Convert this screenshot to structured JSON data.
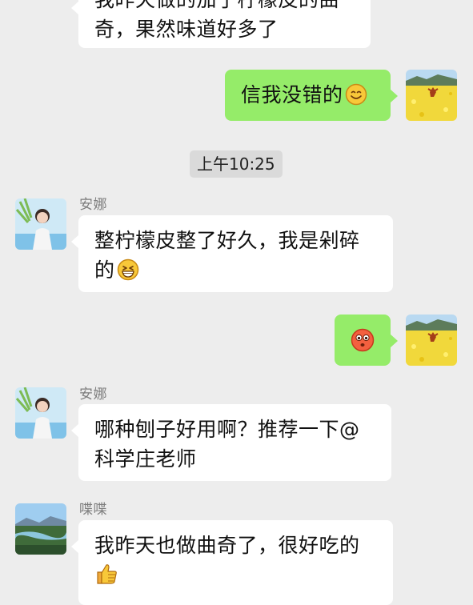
{
  "messages": [
    {
      "text_line1": "我昨天做的加了柠檬皮的曲",
      "text_line2": "奇，果然味道好多了"
    },
    {
      "text": "信我没错的",
      "emoji": "smile-emoji"
    },
    {
      "sender": "安娜",
      "text_line1": "整柠檬皮整了好久，我是剁碎",
      "text_line2": "的",
      "emoji": "grin-emoji"
    },
    {
      "emoji": "blush-emoji"
    },
    {
      "sender": "安娜",
      "text_line1": "哪种刨子好用啊？推荐一下@",
      "text_line2": "科学庄老师"
    },
    {
      "sender": "喋喋",
      "text_line1": "我昨天也做曲奇了，很好吃的",
      "emoji": "thumbs-up-emoji"
    }
  ],
  "timestamp": "上午10:25",
  "colors": {
    "background": "#ededed",
    "incoming_bubble": "#ffffff",
    "outgoing_bubble": "#95ec69",
    "timestamp_bg": "#dadada"
  }
}
